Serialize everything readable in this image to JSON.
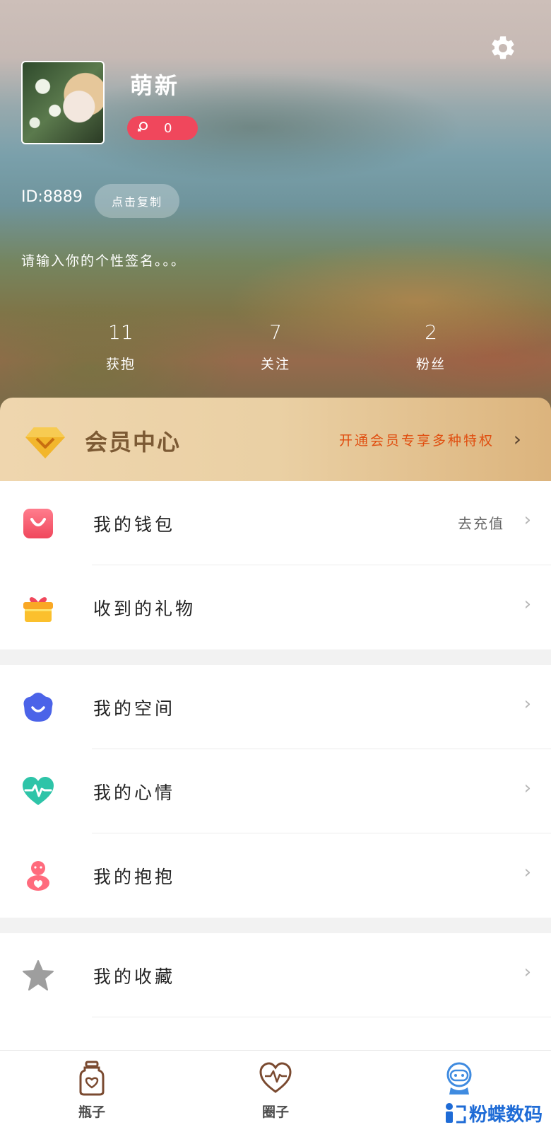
{
  "profile": {
    "username": "萌新",
    "gender_count": "0",
    "id_text": "ID:8889",
    "copy_label": "点击复制",
    "signature": "请输入你的个性签名。。。"
  },
  "stats": [
    {
      "value": "11",
      "label": "获抱"
    },
    {
      "value": "7",
      "label": "关注"
    },
    {
      "value": "2",
      "label": "粉丝"
    }
  ],
  "vip": {
    "title": "会员中心",
    "promo": "开通会员专享多种特权"
  },
  "menu": {
    "group1": [
      {
        "label": "我的钱包",
        "extra": "去充值",
        "icon": "wallet-icon"
      },
      {
        "label": "收到的礼物",
        "extra": "",
        "icon": "gift-icon"
      }
    ],
    "group2": [
      {
        "label": "我的空间",
        "extra": "",
        "icon": "space-icon"
      },
      {
        "label": "我的心情",
        "extra": "",
        "icon": "heartbeat-icon"
      },
      {
        "label": "我的抱抱",
        "extra": "",
        "icon": "hug-icon"
      }
    ],
    "group3": [
      {
        "label": "我的收藏",
        "extra": "",
        "icon": "star-icon"
      }
    ]
  },
  "bottom_nav": [
    {
      "label": "瓶子",
      "icon": "bottle-icon"
    },
    {
      "label": "圈子",
      "icon": "heart-pulse-icon"
    },
    {
      "label": "",
      "icon": "robot-avatar-icon"
    }
  ],
  "watermark": "粉蝶数码",
  "colors": {
    "accent_red": "#f0475c",
    "vip_orange": "#e04e10",
    "vip_brown": "#7c5a34",
    "nav_blue": "#3f8be0"
  }
}
